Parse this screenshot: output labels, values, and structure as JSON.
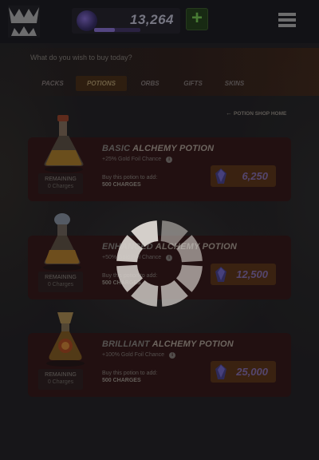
{
  "header": {
    "logo_icon": "monster-teeth-logo-icon",
    "gold_amount": "13,264",
    "progress_fraction": 0.45,
    "plus_label": "+",
    "menu_icon": "hamburger-menu-icon"
  },
  "shop": {
    "prompt": "What do you wish to buy today?",
    "tabs": [
      {
        "label": "PACKS",
        "active": false
      },
      {
        "label": "POTIONS",
        "active": true
      },
      {
        "label": "ORBS",
        "active": false
      },
      {
        "label": "GIFTS",
        "active": false
      },
      {
        "label": "SKINS",
        "active": false
      }
    ],
    "home_link": "POTION SHOP HOME"
  },
  "potions": [
    {
      "prefix": "BASIC",
      "name": "ALCHEMY POTION",
      "subtitle": "+25% Gold Foil Chance",
      "remaining_label": "REMAINING",
      "remaining_value": "0 Charges",
      "buy_label": "Buy this potion to add:",
      "charges": "500 CHARGES",
      "price": "6,250"
    },
    {
      "prefix": "ENHANCED",
      "name": "ALCHEMY POTION",
      "subtitle": "+50% Gold Foil Chance",
      "remaining_label": "REMAINING",
      "remaining_value": "0 Charges",
      "buy_label": "Buy this potion to add:",
      "charges": "500 CHARGES",
      "price": "12,500"
    },
    {
      "prefix": "BRILLIANT",
      "name": "ALCHEMY POTION",
      "subtitle": "+100% Gold Foil Chance",
      "remaining_label": "REMAINING",
      "remaining_value": "0 Charges",
      "buy_label": "Buy this potion to add:",
      "charges": "500 CHARGES",
      "price": "25,000"
    }
  ],
  "colors": {
    "background": "#1b1a1c",
    "card": "#2a1212",
    "active_tab": "#3a2510",
    "price_button": "#4a2a12",
    "plus_button": "#1d3414",
    "spinner": "#d4cfca"
  }
}
